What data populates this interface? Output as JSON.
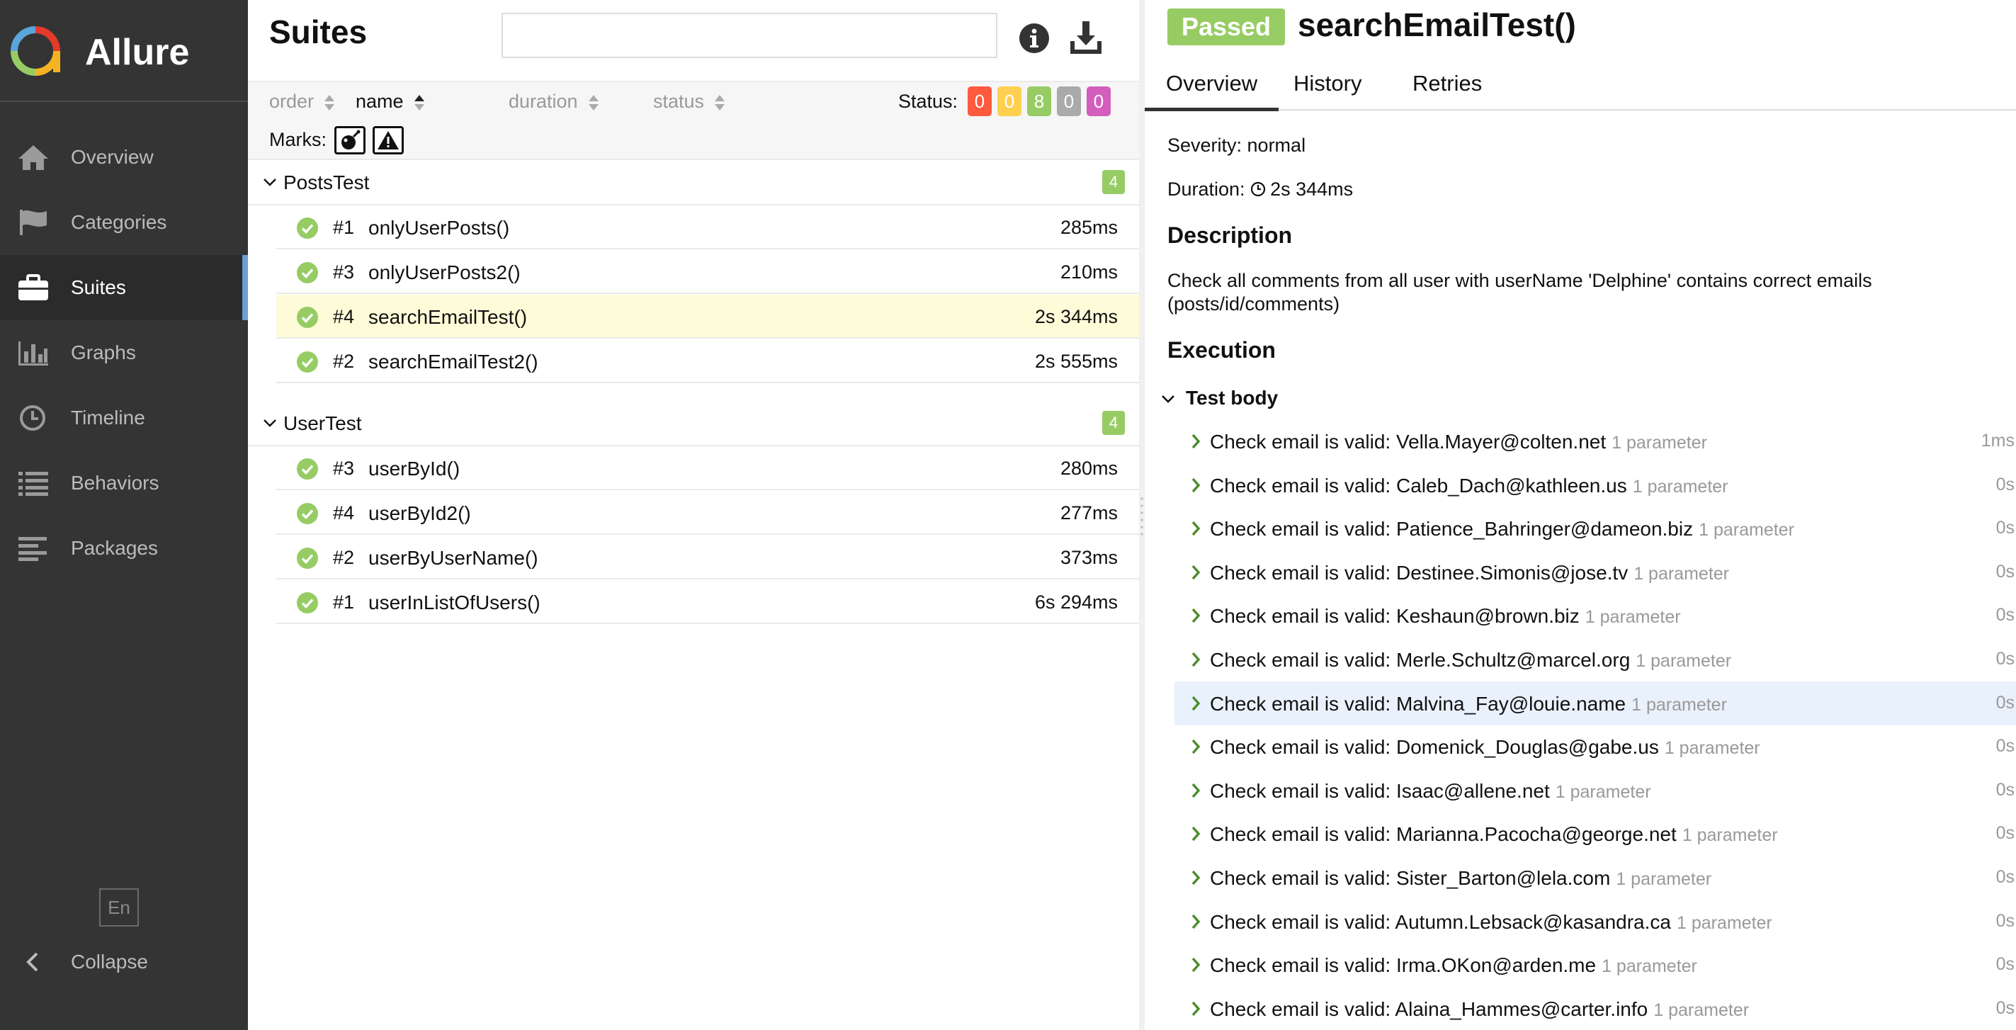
{
  "app": {
    "name": "Allure"
  },
  "sidebar": {
    "items": [
      {
        "label": "Overview",
        "icon": "home-icon"
      },
      {
        "label": "Categories",
        "icon": "flag-icon"
      },
      {
        "label": "Suites",
        "icon": "briefcase-icon",
        "active": true
      },
      {
        "label": "Graphs",
        "icon": "bar-chart-icon"
      },
      {
        "label": "Timeline",
        "icon": "clock-icon"
      },
      {
        "label": "Behaviors",
        "icon": "list-icon"
      },
      {
        "label": "Packages",
        "icon": "align-left-icon"
      }
    ],
    "language": "En",
    "collapse_label": "Collapse"
  },
  "suites": {
    "title": "Suites",
    "search_placeholder": "",
    "sort": {
      "order": "order",
      "name": "name",
      "duration": "duration",
      "status": "status",
      "active": "name"
    },
    "status_label": "Status:",
    "status_counts": [
      {
        "value": "0",
        "color": "#fd5a3e",
        "kind": "failed"
      },
      {
        "value": "0",
        "color": "#ffd050",
        "kind": "broken"
      },
      {
        "value": "8",
        "color": "#97cc64",
        "kind": "passed"
      },
      {
        "value": "0",
        "color": "#aaaaaa",
        "kind": "skipped"
      },
      {
        "value": "0",
        "color": "#d35ebe",
        "kind": "unknown"
      }
    ],
    "marks_label": "Marks:",
    "groups": [
      {
        "name": "PostsTest",
        "count": "4",
        "cases": [
          {
            "order": "#1",
            "name": "onlyUserPosts()",
            "duration": "285ms"
          },
          {
            "order": "#3",
            "name": "onlyUserPosts2()",
            "duration": "210ms"
          },
          {
            "order": "#4",
            "name": "searchEmailTest()",
            "duration": "2s 344ms",
            "selected": true
          },
          {
            "order": "#2",
            "name": "searchEmailTest2()",
            "duration": "2s 555ms"
          }
        ]
      },
      {
        "name": "UserTest",
        "count": "4",
        "cases": [
          {
            "order": "#3",
            "name": "userById()",
            "duration": "280ms"
          },
          {
            "order": "#4",
            "name": "userById2()",
            "duration": "277ms"
          },
          {
            "order": "#2",
            "name": "userByUserName()",
            "duration": "373ms"
          },
          {
            "order": "#1",
            "name": "userInListOfUsers()",
            "duration": "6s 294ms"
          }
        ]
      }
    ]
  },
  "details": {
    "status": "Passed",
    "status_color": "#97cc64",
    "title": "searchEmailTest()",
    "tabs": [
      "Overview",
      "History",
      "Retries"
    ],
    "active_tab": "Overview",
    "severity": "Severity: normal",
    "duration_label": "Duration:",
    "duration_value": "2s 344ms",
    "description_title": "Description",
    "description": "Check all comments from all user with userName 'Delphine' contains correct emails (posts/id/comments)",
    "execution_title": "Execution",
    "test_body_label": "Test body",
    "steps": [
      {
        "text": "Check email is valid: Vella.Mayer@colten.net",
        "param": "1 parameter",
        "duration": "1ms"
      },
      {
        "text": "Check email is valid: Caleb_Dach@kathleen.us",
        "param": "1 parameter",
        "duration": "0s"
      },
      {
        "text": "Check email is valid: Patience_Bahringer@dameon.biz",
        "param": "1 parameter",
        "duration": "0s"
      },
      {
        "text": "Check email is valid: Destinee.Simonis@jose.tv",
        "param": "1 parameter",
        "duration": "0s"
      },
      {
        "text": "Check email is valid: Keshaun@brown.biz",
        "param": "1 parameter",
        "duration": "0s"
      },
      {
        "text": "Check email is valid: Merle.Schultz@marcel.org",
        "param": "1 parameter",
        "duration": "0s"
      },
      {
        "text": "Check email is valid: Malvina_Fay@louie.name",
        "param": "1 parameter",
        "duration": "0s",
        "hover": true
      },
      {
        "text": "Check email is valid: Domenick_Douglas@gabe.us",
        "param": "1 parameter",
        "duration": "0s"
      },
      {
        "text": "Check email is valid: Isaac@allene.net",
        "param": "1 parameter",
        "duration": "0s"
      },
      {
        "text": "Check email is valid: Marianna.Pacocha@george.net",
        "param": "1 parameter",
        "duration": "0s"
      },
      {
        "text": "Check email is valid: Sister_Barton@lela.com",
        "param": "1 parameter",
        "duration": "0s"
      },
      {
        "text": "Check email is valid: Autumn.Lebsack@kasandra.ca",
        "param": "1 parameter",
        "duration": "0s"
      },
      {
        "text": "Check email is valid: Irma.OKon@arden.me",
        "param": "1 parameter",
        "duration": "0s"
      },
      {
        "text": "Check email is valid: Alaina_Hammes@carter.info",
        "param": "1 parameter",
        "duration": "0s"
      }
    ]
  }
}
